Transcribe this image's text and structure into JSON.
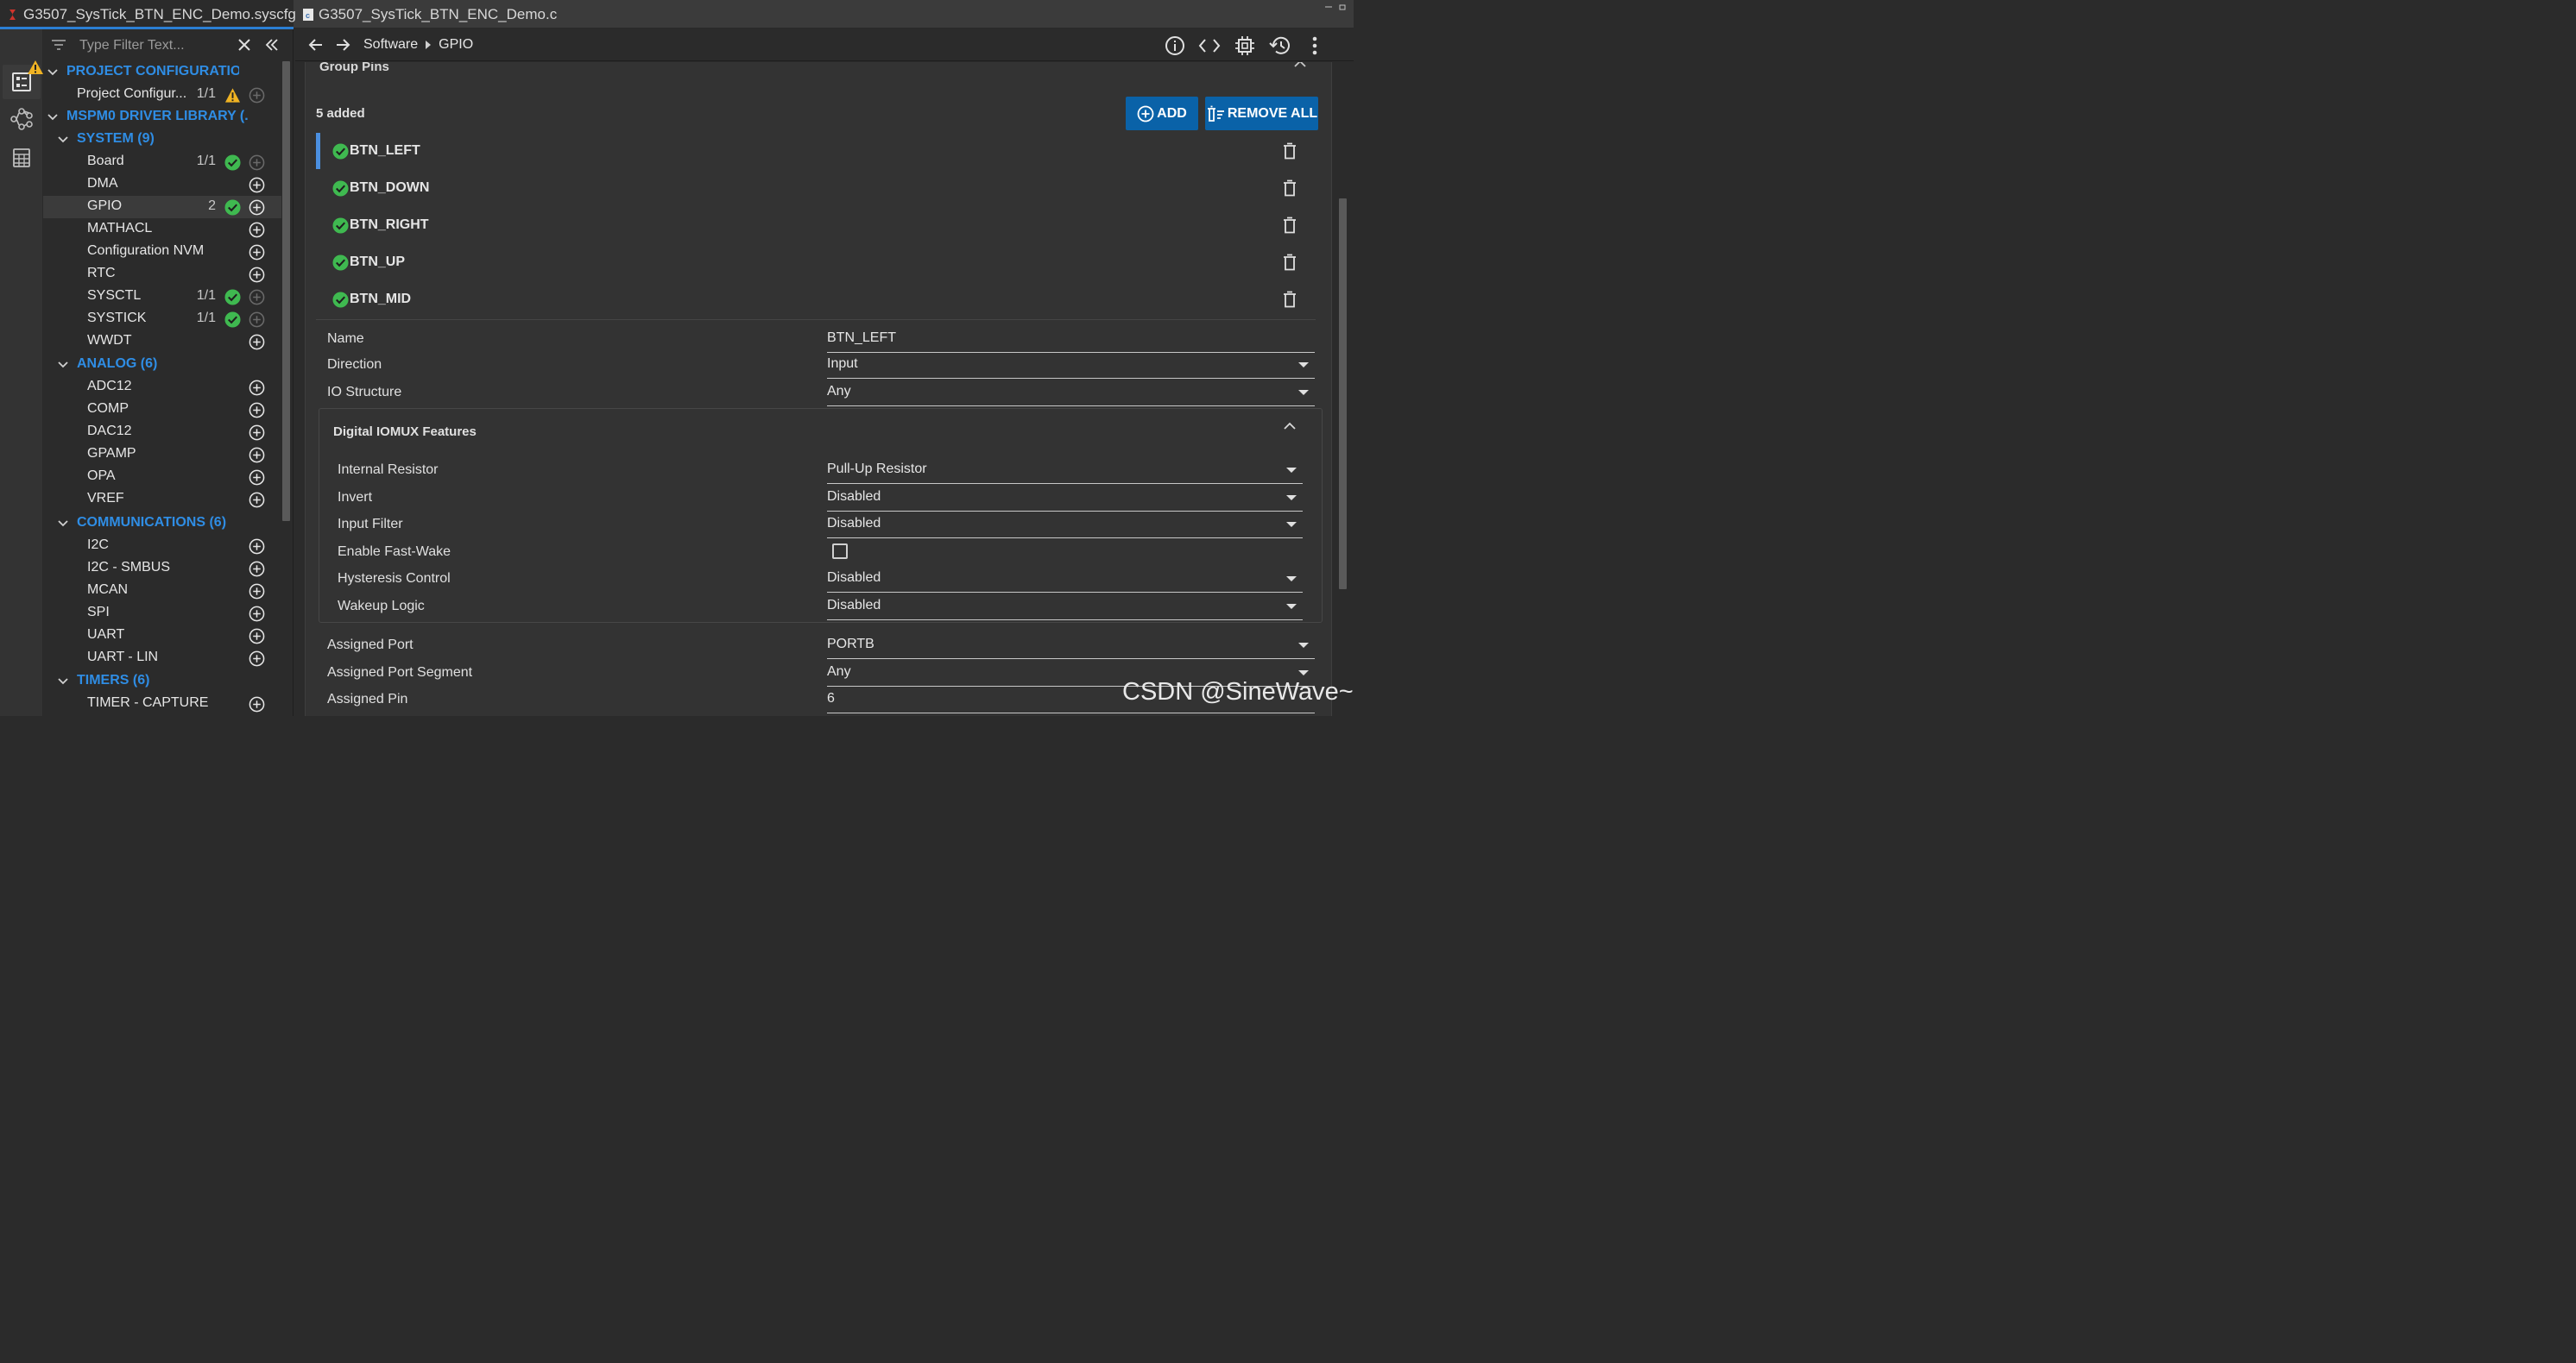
{
  "tabs": [
    {
      "label": "G3507_SysTick_BTN_ENC_Demo.syscfg",
      "icon": "syscfg-file-icon",
      "active": true
    },
    {
      "label": "G3507_SysTick_BTN_ENC_Demo.c",
      "icon": "c-file-icon",
      "active": false
    }
  ],
  "filter": {
    "placeholder": "Type Filter Text..."
  },
  "tree": {
    "project_config": {
      "label": "PROJECT CONFIGURATIO...",
      "warning": true
    },
    "project_config_item": {
      "label": "Project Configur...",
      "count": "1/1",
      "status": "warning"
    },
    "mspm0": {
      "label": "MSPM0 DRIVER LIBRARY (..."
    },
    "system": {
      "label": "SYSTEM (9)"
    },
    "system_items": [
      {
        "label": "Board",
        "count": "1/1",
        "status": "ok"
      },
      {
        "label": "DMA",
        "count": "",
        "status": ""
      },
      {
        "label": "GPIO",
        "count": "2",
        "status": "ok"
      },
      {
        "label": "MATHACL",
        "count": "",
        "status": ""
      },
      {
        "label": "Configuration NVM",
        "count": "",
        "status": ""
      },
      {
        "label": "RTC",
        "count": "",
        "status": ""
      },
      {
        "label": "SYSCTL",
        "count": "1/1",
        "status": "ok"
      },
      {
        "label": "SYSTICK",
        "count": "1/1",
        "status": "ok"
      },
      {
        "label": "WWDT",
        "count": "",
        "status": ""
      }
    ],
    "analog": {
      "label": "ANALOG (6)"
    },
    "analog_items": [
      {
        "label": "ADC12"
      },
      {
        "label": "COMP"
      },
      {
        "label": "DAC12"
      },
      {
        "label": "GPAMP"
      },
      {
        "label": "OPA"
      },
      {
        "label": "VREF"
      }
    ],
    "communications": {
      "label": "COMMUNICATIONS (6)"
    },
    "communications_items": [
      {
        "label": "I2C"
      },
      {
        "label": "I2C - SMBUS"
      },
      {
        "label": "MCAN"
      },
      {
        "label": "SPI"
      },
      {
        "label": "UART"
      },
      {
        "label": "UART - LIN"
      }
    ],
    "timers": {
      "label": "TIMERS (6)"
    },
    "timers_items": [
      {
        "label": "TIMER - CAPTURE"
      }
    ]
  },
  "breadcrumb": {
    "parent": "Software",
    "current": "GPIO"
  },
  "group_pins": {
    "title": "Group Pins",
    "added_label": "5 added",
    "add_label": "ADD",
    "remove_all_label": "REMOVE ALL",
    "pins": [
      {
        "name": "BTN_LEFT",
        "selected": true
      },
      {
        "name": "BTN_DOWN",
        "selected": false
      },
      {
        "name": "BTN_RIGHT",
        "selected": false
      },
      {
        "name": "BTN_UP",
        "selected": false
      },
      {
        "name": "BTN_MID",
        "selected": false
      }
    ]
  },
  "config": {
    "name": {
      "label": "Name",
      "value": "BTN_LEFT"
    },
    "direction": {
      "label": "Direction",
      "value": "Input"
    },
    "io_structure": {
      "label": "IO Structure",
      "value": "Any"
    },
    "iomux": {
      "title": "Digital IOMUX Features",
      "internal_resistor": {
        "label": "Internal Resistor",
        "value": "Pull-Up Resistor"
      },
      "invert": {
        "label": "Invert",
        "value": "Disabled"
      },
      "input_filter": {
        "label": "Input Filter",
        "value": "Disabled"
      },
      "fast_wake": {
        "label": "Enable Fast-Wake",
        "checked": false
      },
      "hysteresis": {
        "label": "Hysteresis Control",
        "value": "Disabled"
      },
      "wakeup": {
        "label": "Wakeup Logic",
        "value": "Disabled"
      }
    },
    "assigned_port": {
      "label": "Assigned Port",
      "value": "PORTB"
    },
    "assigned_port_segment": {
      "label": "Assigned Port Segment",
      "value": "Any"
    },
    "assigned_pin": {
      "label": "Assigned Pin",
      "value": "6"
    }
  },
  "watermark": "CSDN @SineWave~",
  "colors": {
    "accent": "#2f8de4",
    "button": "#0a62a8",
    "ok": "#3fb950",
    "warning": "#f0b323",
    "background": "#2b2b2b"
  }
}
